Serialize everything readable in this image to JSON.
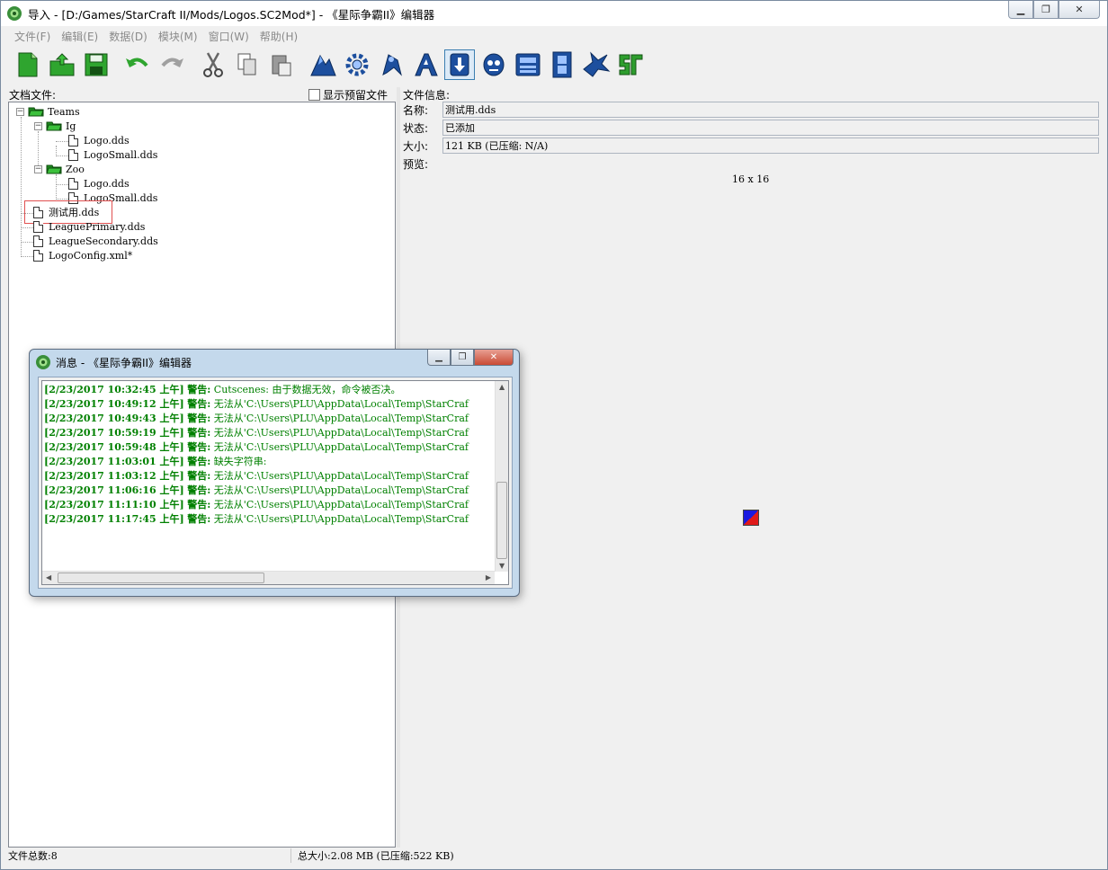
{
  "window": {
    "title": "导入 - [D:/Games/StarCraft II/Mods/Logos.SC2Mod*] - 《星际争霸II》编辑器",
    "minimize_icon": "minimize-icon",
    "maximize_icon": "restore-icon",
    "close_icon": "close-icon"
  },
  "menu": [
    "文件(F)",
    "编辑(E)",
    "数据(D)",
    "模块(M)",
    "窗口(W)",
    "帮助(H)"
  ],
  "toolbar": [
    "new-document-icon",
    "open-icon",
    "save-icon",
    "undo-icon",
    "redo-icon",
    "cut-icon",
    "copy-icon",
    "paste-icon",
    "terrain-icon",
    "triggers-icon",
    "data-icon",
    "text-icon",
    "import-icon",
    "ai-icon",
    "cutscene-icon",
    "video-icon",
    "previewer-icon",
    "sc-logo-icon"
  ],
  "left_pane": {
    "label": "文档文件:",
    "show_reserved_label": "显示预留文件",
    "tree": {
      "teams": "Teams",
      "ig": "Ig",
      "ig_logo": "Logo.dds",
      "ig_logosmall": "LogoSmall.dds",
      "zoo": "Zoo",
      "zoo_logo": "Logo.dds",
      "zoo_logosmall": "LogoSmall.dds",
      "test": "测试用.dds",
      "league_primary": "LeaguePrimary.dds",
      "league_secondary": "LeagueSecondary.dds",
      "logo_config": "LogoConfig.xml*"
    }
  },
  "right_pane": {
    "heading": "文件信息:",
    "name_label": "名称:",
    "name_value": "测试用.dds",
    "status_label": "状态:",
    "status_value": "已添加",
    "size_label": "大小:",
    "size_value": "121 KB (已压缩: N/A)",
    "preview_label": "预览:",
    "preview_dims": "16 x 16"
  },
  "statusbar": {
    "total_files": "文件总数:8",
    "total_size": "总大小:2.08 MB (已压缩:522 KB)"
  },
  "dialog": {
    "title": "消息 - 《星际争霸II》编辑器",
    "log": [
      {
        "ts": "[2/23/2017 10:32:45 上午]",
        "level": "警告:",
        "msg": "Cutscenes: 由于数据无效，命令被否决。"
      },
      {
        "ts": "[2/23/2017 10:49:12 上午]",
        "level": "警告:",
        "msg": "无法从'C:\\Users\\PLU\\AppData\\Local\\Temp\\StarCraf"
      },
      {
        "ts": "[2/23/2017 10:49:43 上午]",
        "level": "警告:",
        "msg": "无法从'C:\\Users\\PLU\\AppData\\Local\\Temp\\StarCraf"
      },
      {
        "ts": "[2/23/2017 10:59:19 上午]",
        "level": "警告:",
        "msg": "无法从'C:\\Users\\PLU\\AppData\\Local\\Temp\\StarCraf"
      },
      {
        "ts": "[2/23/2017 10:59:48 上午]",
        "level": "警告:",
        "msg": "无法从'C:\\Users\\PLU\\AppData\\Local\\Temp\\StarCraf"
      },
      {
        "ts": "[2/23/2017 11:03:01 上午]",
        "level": "警告:",
        "msg": "缺失字符串:"
      },
      {
        "ts": "[2/23/2017 11:03:12 上午]",
        "level": "警告:",
        "msg": "无法从'C:\\Users\\PLU\\AppData\\Local\\Temp\\StarCraf"
      },
      {
        "ts": "[2/23/2017 11:06:16 上午]",
        "level": "警告:",
        "msg": "无法从'C:\\Users\\PLU\\AppData\\Local\\Temp\\StarCraf"
      },
      {
        "ts": "[2/23/2017 11:11:10 上午]",
        "level": "警告:",
        "msg": "无法从'C:\\Users\\PLU\\AppData\\Local\\Temp\\StarCraf"
      },
      {
        "ts": "[2/23/2017 11:17:45 上午]",
        "level": "警告:",
        "msg": "无法从'C:\\Users\\PLU\\AppData\\Local\\Temp\\StarCraf"
      }
    ]
  },
  "colors": {
    "log_text": "#008000",
    "highlight_box": "#e05050",
    "toolbar_selected": "#dceaf7",
    "icon_blue": "#1d4f9e",
    "icon_green": "#2e9e2e"
  }
}
